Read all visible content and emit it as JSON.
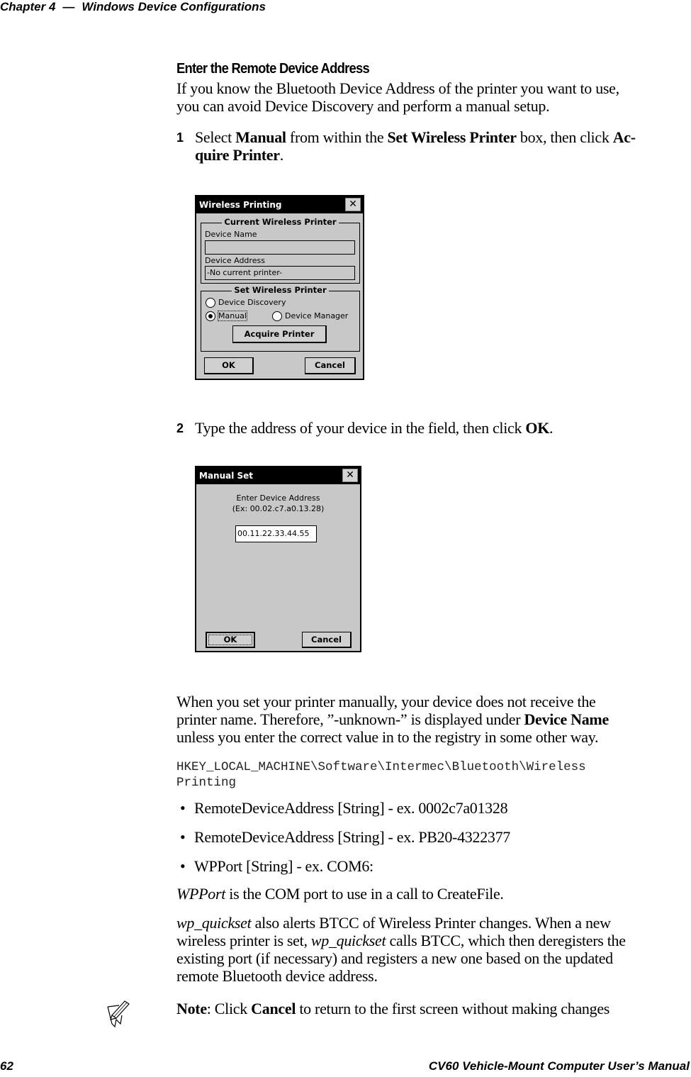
{
  "header": {
    "chapter": "Chapter 4",
    "dash": "—",
    "title": "Windows Device Configurations"
  },
  "section": {
    "title": "Enter the Remote Device Address",
    "intro_line1": "If you know the Bluetooth Device Address of the printer you want to use,",
    "intro_line2": "you can avoid Device Discovery and perform a manual setup."
  },
  "steps": [
    {
      "number": "1",
      "pre": "Select ",
      "b1": "Manual",
      "mid1": " from within the ",
      "b2": "Set Wireless Printer",
      "mid2": " box, then click ",
      "b3a": "Ac-",
      "b3b": "quire Printer",
      "end": "."
    },
    {
      "number": "2",
      "pre": "Type the address of your device in the field, then click ",
      "b1": "OK",
      "end": "."
    }
  ],
  "dialog_wireless_printing": {
    "title": "Wireless Printing",
    "close_glyph": "✕",
    "current_group": "Current Wireless Printer",
    "device_name_label": "Device Name",
    "device_name_value": "",
    "device_address_label": "Device Address",
    "device_address_value": "-No current printer-",
    "set_group": "Set Wireless Printer",
    "radio_discovery": "Device Discovery",
    "radio_manual": "Manual",
    "radio_manager": "Device Manager",
    "selected_radio": "Manual",
    "acquire_button": "Acquire Printer",
    "ok_button": "OK",
    "cancel_button": "Cancel"
  },
  "dialog_manual_set": {
    "title": "Manual Set",
    "close_glyph": "✕",
    "prompt_line1": "Enter Device Address",
    "prompt_line2": "(Ex: 00.02.c7.a0.13.28)",
    "address_value": "00.11.22.33.44.55",
    "ok_button": "OK",
    "cancel_button": "Cancel"
  },
  "body": {
    "manual_para_line1": "When you set your printer manually, your device does not receive the",
    "manual_para_line2_pre": "printer name. Therefore, ”-unknown-” is displayed under ",
    "manual_para_line2_bold": "Device Name",
    "manual_para_line3": "unless you enter the correct value in to the registry in some other way.",
    "registry_line1": "HKEY_LOCAL_MACHINE\\Software\\Intermec\\Bluetooth\\Wireless",
    "registry_line2": "Printing",
    "bullet_glyph": "•",
    "bullets": [
      "RemoteDeviceAddress [String] - ex. 0002c7a01328",
      "RemoteDeviceAddress [String] - ex. PB20-4322377",
      "WPPort [String] - ex. COM6:"
    ],
    "wpport_italic": "WPPort",
    "wpport_rest": " is the COM port to use in a call to CreateFile.",
    "quickset_italic1": "wp_quickset",
    "quickset_line1_rest": " also alerts BTCC of Wireless Printer changes. When a new",
    "quickset_line2_pre": "wireless printer is set, ",
    "quickset_italic2": "wp_quickset",
    "quickset_line2_rest": " calls BTCC, which then deregisters the",
    "quickset_line3": "existing port (if necessary) and registers a new one based on the updated",
    "quickset_line4": "remote Bluetooth device address."
  },
  "note": {
    "icon": "pencil-note-icon",
    "label": "Note",
    "pre": ": Click ",
    "bold": "Cancel",
    "rest": " to return to the first screen without making changes"
  },
  "footer": {
    "page_number": "62",
    "manual_title": "CV60 Vehicle-Mount Computer User’s Manual"
  }
}
